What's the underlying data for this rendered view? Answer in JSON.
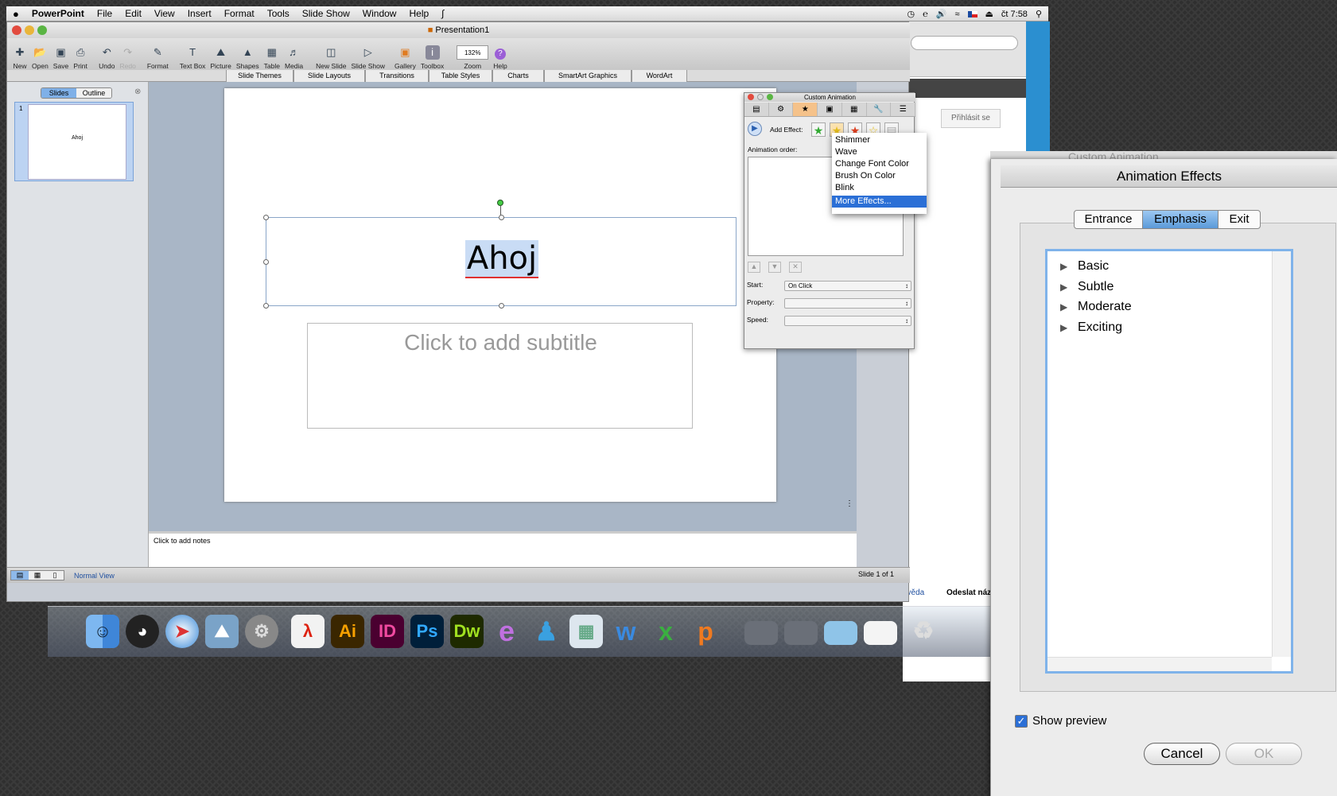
{
  "menubar": {
    "apple": "",
    "app": "PowerPoint",
    "items": [
      "File",
      "Edit",
      "View",
      "Insert",
      "Format",
      "Tools",
      "Slide Show",
      "Window",
      "Help"
    ],
    "clock": "čt 7:58"
  },
  "window": {
    "title": "Presentation1"
  },
  "toolbar": [
    "New",
    "Open",
    "Save",
    "Print",
    "Undo",
    "Redo",
    "Format",
    "Text Box",
    "Picture",
    "Shapes",
    "Table",
    "Media",
    "New Slide",
    "Slide Show",
    "Gallery",
    "Toolbox",
    "Zoom",
    "Help"
  ],
  "zoom": "132%",
  "ribbon": [
    "Slide Themes",
    "Slide Layouts",
    "Transitions",
    "Table Styles",
    "Charts",
    "SmartArt Graphics",
    "WordArt"
  ],
  "sidepane": {
    "tabs": [
      "Slides",
      "Outline"
    ],
    "slide_number": "1",
    "thumb_text": "Ahoj"
  },
  "slide": {
    "title": "Ahoj",
    "subtitle_placeholder": "Click to add subtitle"
  },
  "notes_placeholder": "Click to add notes",
  "status": {
    "view": "Normal View",
    "slide": "Slide 1 of 1"
  },
  "browser": {
    "login": "Přihlásit se",
    "foot1": "ověda",
    "foot2": "Odeslat náz"
  },
  "custom_animation": {
    "title": "Custom Animation",
    "add_effect": "Add Effect:",
    "animation_order": "Animation order:",
    "start_label": "Start:",
    "start_value": "On Click",
    "property_label": "Property:",
    "speed_label": "Speed:"
  },
  "effects_menu": {
    "items": [
      "Shimmer",
      "Wave",
      "Change Font Color",
      "Brush On Color",
      "Blink"
    ],
    "more": "More Effects..."
  },
  "dock": [
    "Finder",
    "Dashboard",
    "Safari",
    "iPhoto",
    "System Preferences",
    "Acrobat",
    "Ai",
    "ID",
    "Ps",
    "Dw",
    "Entourage",
    "Messenger",
    "Excel",
    "Word",
    "Project Gallery",
    "PowerPoint",
    "Downloads",
    "Documents",
    "Folder",
    "Preview",
    "Trash"
  ],
  "effects_dialog": {
    "ghost_title": "Custom Animation",
    "title": "Animation Effects",
    "tabs": [
      "Entrance",
      "Emphasis",
      "Exit"
    ],
    "selected_tab": "Emphasis",
    "categories": [
      "Basic",
      "Subtle",
      "Moderate",
      "Exciting"
    ],
    "show_preview": "Show preview",
    "cancel": "Cancel",
    "ok": "OK"
  }
}
